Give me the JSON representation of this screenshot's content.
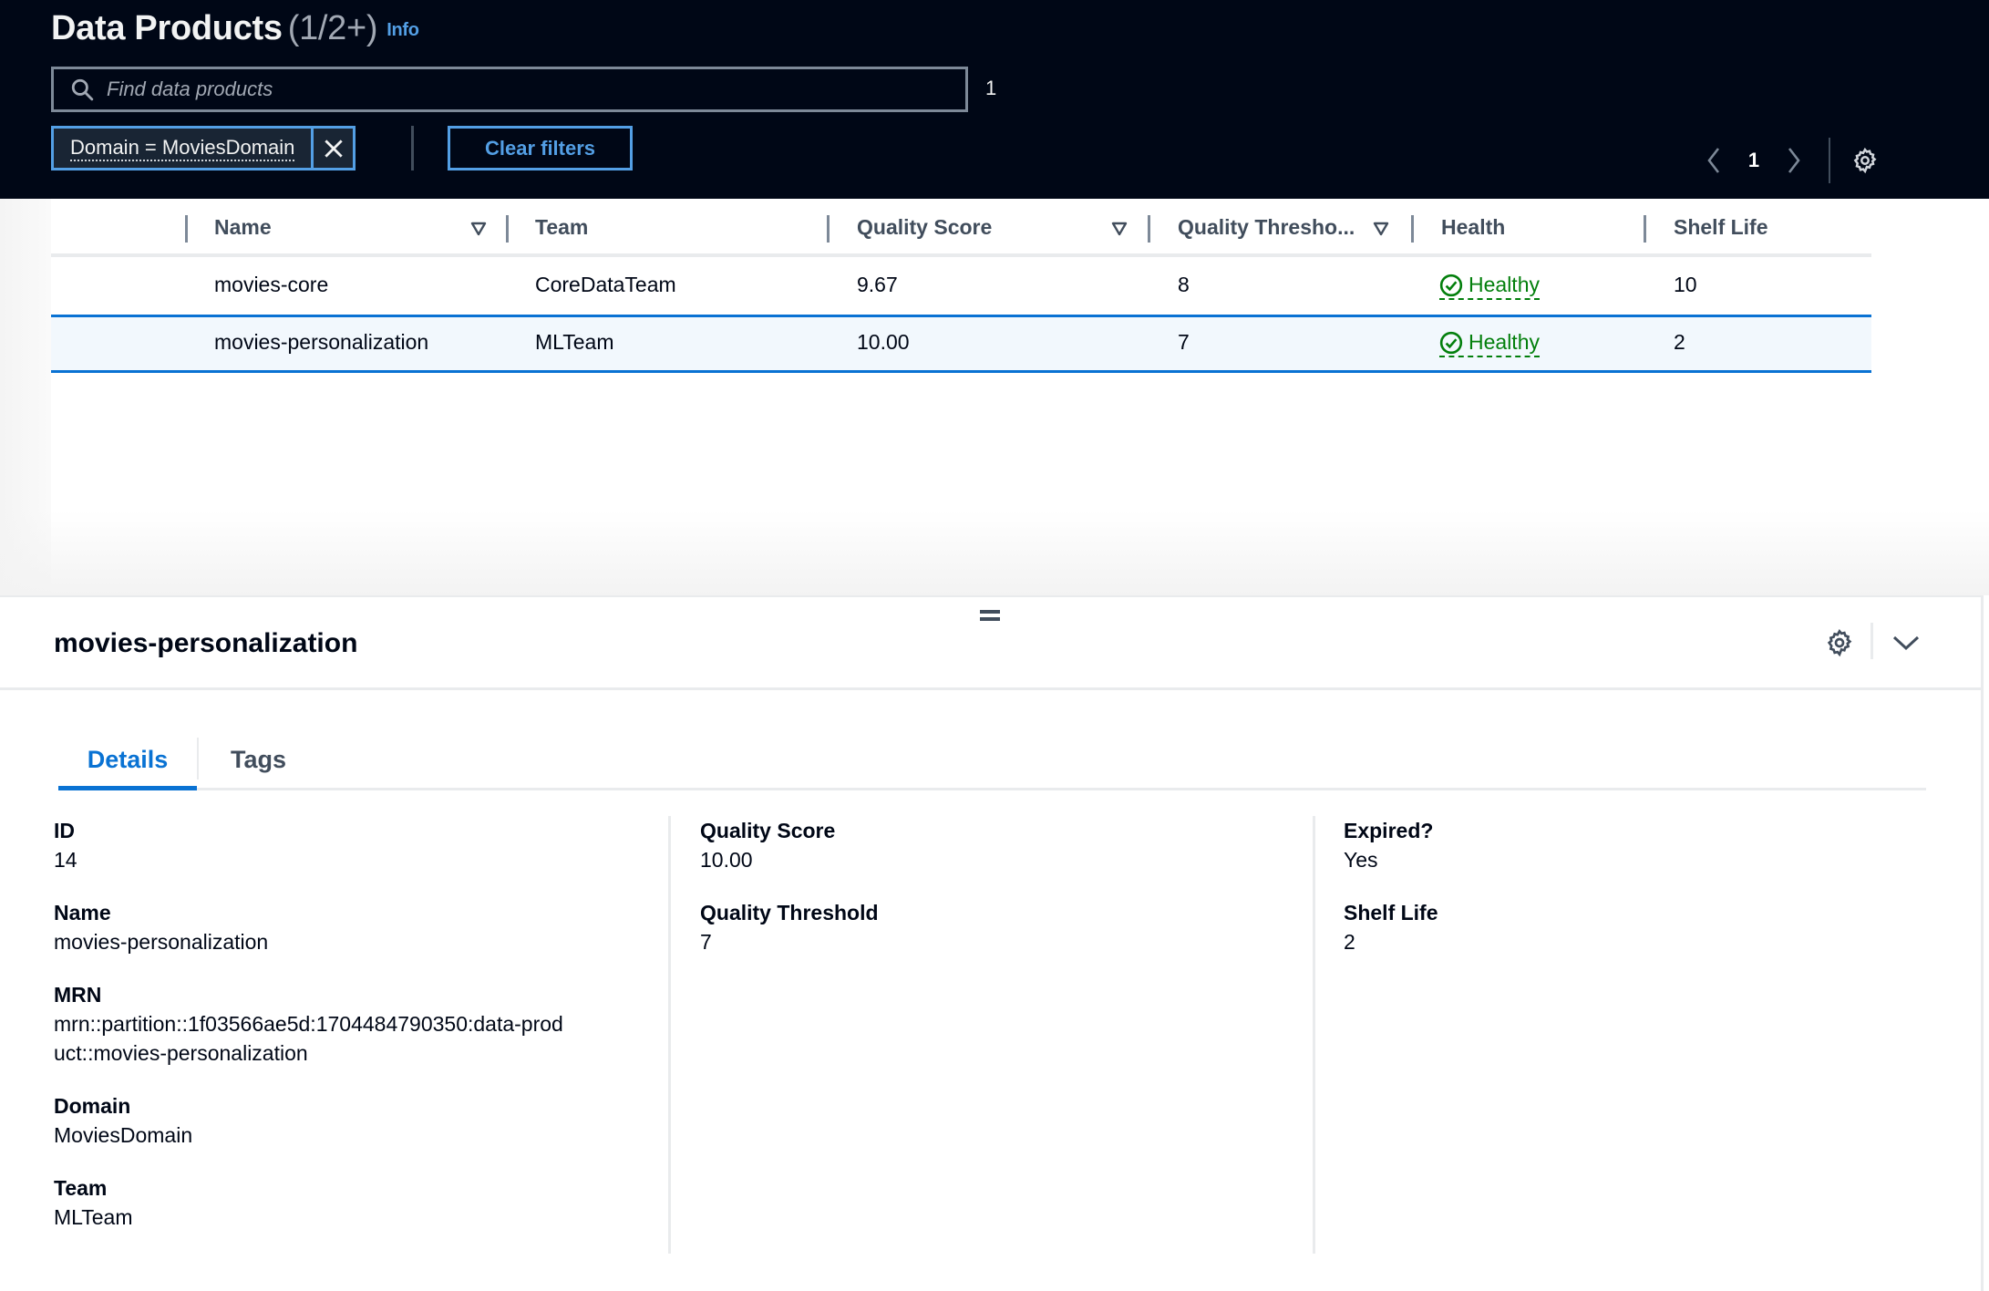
{
  "header": {
    "title": "Data Products",
    "count": "(1/2+)",
    "info_link": "Info",
    "search": {
      "placeholder": "Find data products",
      "value": ""
    },
    "match_count": "1",
    "filter_token": {
      "label": "Domain = MoviesDomain"
    },
    "clear_filters_label": "Clear filters",
    "pagination": {
      "current_page": "1"
    }
  },
  "table": {
    "columns": [
      {
        "label": "Name",
        "filterable": true
      },
      {
        "label": "Team",
        "filterable": false
      },
      {
        "label": "Quality Score",
        "filterable": true
      },
      {
        "label": "Quality Thresho...",
        "filterable": true
      },
      {
        "label": "Health",
        "filterable": false
      },
      {
        "label": "Shelf Life",
        "filterable": false
      }
    ],
    "rows": [
      {
        "name": "movies-core",
        "team": "CoreDataTeam",
        "quality_score": "9.67",
        "quality_threshold": "8",
        "health": "Healthy",
        "shelf_life": "10",
        "selected": false
      },
      {
        "name": "movies-personalization",
        "team": "MLTeam",
        "quality_score": "10.00",
        "quality_threshold": "7",
        "health": "Healthy",
        "shelf_life": "2",
        "selected": true
      }
    ]
  },
  "split_panel": {
    "title": "movies-personalization",
    "tabs": [
      {
        "label": "Details",
        "active": true
      },
      {
        "label": "Tags",
        "active": false
      }
    ],
    "details": {
      "col1": [
        {
          "label": "ID",
          "value": "14"
        },
        {
          "label": "Name",
          "value": "movies-personalization"
        },
        {
          "label": "MRN",
          "value": "mrn::partition::1f03566ae5d:1704484790350:data-product::movies-personalization"
        },
        {
          "label": "Domain",
          "value": "MoviesDomain"
        },
        {
          "label": "Team",
          "value": "MLTeam"
        }
      ],
      "col2": [
        {
          "label": "Quality Score",
          "value": "10.00"
        },
        {
          "label": "Quality Threshold",
          "value": "7"
        }
      ],
      "col3": [
        {
          "label": "Expired?",
          "value": "Yes"
        },
        {
          "label": "Shelf Life",
          "value": "2"
        }
      ]
    }
  },
  "colors": {
    "header_bg": "#000716",
    "accent_blue": "#539fe5",
    "link_blue": "#0972d3",
    "healthy_green": "#037f0c",
    "selected_row_bg": "#f2f8fd"
  },
  "icons": {
    "search": "search-icon",
    "remove_filter": "close-icon",
    "prev_page": "chevron-left-icon",
    "next_page": "chevron-right-icon",
    "settings": "gear-icon",
    "filter": "filter-triangle-icon",
    "healthy": "check-circle-icon",
    "collapse": "chevron-down-icon",
    "resize_handle": "drag-handle-icon"
  }
}
